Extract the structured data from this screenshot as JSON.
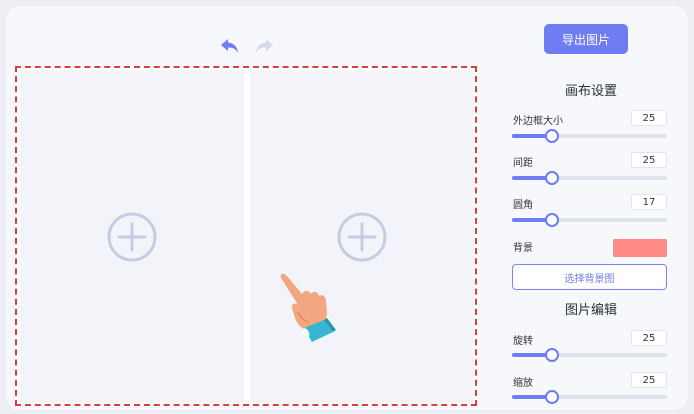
{
  "toolbar": {
    "undo_icon": "undo-arrow-icon",
    "redo_icon": "redo-arrow-icon"
  },
  "canvas": {
    "cells": [
      {
        "icon": "add-circle-icon"
      },
      {
        "icon": "add-circle-icon"
      }
    ],
    "cursor_icon": "pointing-hand-icon"
  },
  "panel": {
    "export_label": "导出图片",
    "canvas_settings": {
      "title": "画布设置",
      "border": {
        "label": "外边框大小",
        "value": "25",
        "fraction": 0.26
      },
      "spacing": {
        "label": "间距",
        "value": "25",
        "fraction": 0.26
      },
      "corner": {
        "label": "圆角",
        "value": "17",
        "fraction": 0.26
      },
      "background": {
        "label": "背景",
        "color": "#ff8a85"
      },
      "choose_bg_label": "选择背景图"
    },
    "image_edit": {
      "title": "图片编辑",
      "rotate": {
        "label": "旋转",
        "value": "25",
        "fraction": 0.26
      },
      "zoom": {
        "label": "缩放",
        "value": "25",
        "fraction": 0.26
      }
    }
  },
  "colors": {
    "accent": "#6f7cf3",
    "canvas_border": "#d64040",
    "cell_bg": "#f2f4f9"
  }
}
